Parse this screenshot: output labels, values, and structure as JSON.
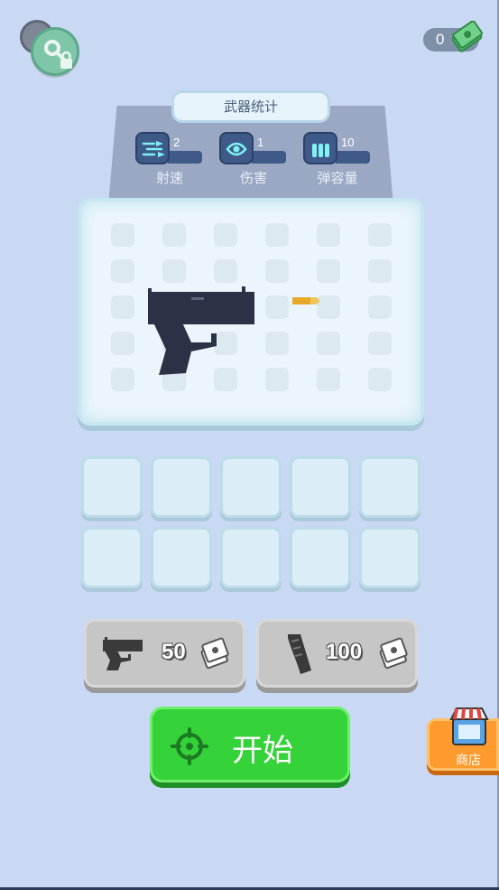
{
  "currency": {
    "amount": "0",
    "icon": "cash-icon"
  },
  "stats": {
    "title": "武器统计",
    "items": [
      {
        "label": "射速",
        "value": "2",
        "icon": "fire-rate-icon"
      },
      {
        "label": "伤害",
        "value": "1",
        "icon": "damage-icon"
      },
      {
        "label": "弹容量",
        "value": "10",
        "icon": "ammo-capacity-icon"
      }
    ]
  },
  "purchases": [
    {
      "item": "pistol",
      "price": "50",
      "icon": "pistol-icon"
    },
    {
      "item": "magazine",
      "price": "100",
      "icon": "magazine-icon"
    }
  ],
  "start_button": {
    "label": "开始",
    "icon": "crosshair-icon"
  },
  "shop_button": {
    "label": "商店",
    "icon": "shop-icon"
  },
  "colors": {
    "background": "#c9d8f3",
    "start_green": "#35d23a",
    "shop_orange": "#ff9b2e",
    "panel_blue": "#3f5a88"
  }
}
